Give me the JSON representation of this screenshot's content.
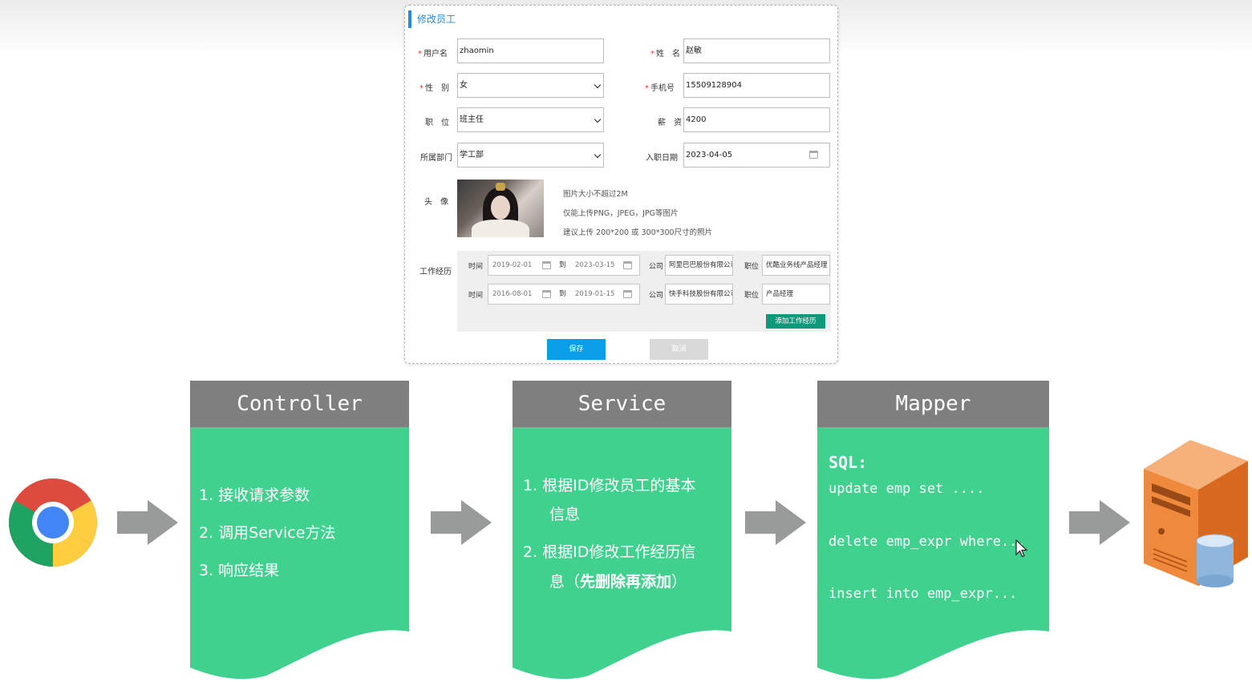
{
  "dialog": {
    "title": "修改员工",
    "labels": {
      "username": "用户名",
      "name": "姓　名",
      "gender": "性　别",
      "phone": "手机号",
      "position": "职　位",
      "salary": "薪　资",
      "department": "所属部门",
      "entry_date": "入职日期",
      "avatar": "头　像",
      "work_experience": "工作经历"
    },
    "required_mark": "*",
    "values": {
      "username": "zhaomin",
      "name": "赵敏",
      "gender": "女",
      "phone": "15509128904",
      "position": "班主任",
      "salary": "4200",
      "department": "学工部",
      "entry_date": "2023-04-05"
    },
    "avatar_hints": [
      "图片大小不超过2M",
      "仅能上传PNG，JPEG，JPG等图片",
      "建议上传 200*200 或 300*300尺寸的照片"
    ],
    "experience_labels": {
      "time": "时间",
      "to": "到",
      "company": "公司",
      "job": "职位"
    },
    "experiences": [
      {
        "start": "2019-02-01",
        "end": "2023-03-15",
        "company": "阿里巴巴股份有限公司",
        "job": "优酷业务线产品经理"
      },
      {
        "start": "2016-08-01",
        "end": "2019-01-15",
        "company": "快手科技股份有限公司",
        "job": "产品经理"
      }
    ],
    "add_experience_button": "添加工作经历",
    "save_button": "保存",
    "cancel_button": "取消"
  },
  "flow": {
    "controller": {
      "title": "Controller",
      "items": [
        "1. 接收请求参数",
        "2. 调用Service方法",
        "3. 响应结果"
      ]
    },
    "service": {
      "title": "Service",
      "items": [
        {
          "line1": "1. 根据ID修改员工的基本",
          "line2": "信息"
        },
        {
          "line1": "2. 根据ID修改工作经历信",
          "line2_prefix": "息（",
          "line2_bold": "先删除再添加",
          "line2_suffix": "）"
        }
      ]
    },
    "mapper": {
      "title": "Mapper",
      "sql_label": "SQL:",
      "statements": [
        "update emp set ....",
        "delete emp_expr where...",
        "insert into emp_expr..."
      ]
    }
  },
  "colors": {
    "box_green": "#40d18f",
    "box_header": "#7f7f7f",
    "arrow": "#999b9a",
    "accent_blue": "#0a9ee8",
    "add_button": "#0e9a7a"
  },
  "icons": [
    "chrome-browser-icon",
    "server-database-icon",
    "arrow-right-icon",
    "mouse-cursor-icon",
    "calendar-icon"
  ]
}
